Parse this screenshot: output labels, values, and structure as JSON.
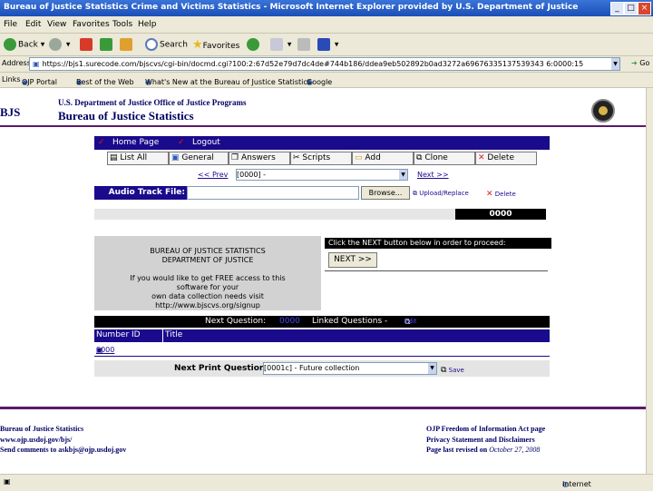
{
  "window": {
    "title": "Bureau of Justice Statistics Crime and Victims Statistics - Microsoft Internet Explorer provided by U.S. Department of Justice"
  },
  "menu": [
    "File",
    "Edit",
    "View",
    "Favorites",
    "Tools",
    "Help"
  ],
  "toolbar": {
    "back": "Back",
    "search": "Search",
    "favorites": "Favorites"
  },
  "address": {
    "label": "Address",
    "url": "https://bjs1.surecode.com/bjscvs/cgi-bin/docmd.cgi?100:2:67d52e79d7dc4de#744b186/ddea9eb502892b0ad3272a69676335137539343 6:0000:15",
    "go": "Go"
  },
  "links": {
    "label": "Links",
    "items": [
      "OJP Portal",
      "Best of the Web",
      "What's New at the Bureau of Justice Statistics",
      "Google"
    ]
  },
  "header": {
    "logo": "BJS",
    "line1": "U.S. Department of Justice Office of Justice Programs",
    "line2": "Bureau of Justice Statistics"
  },
  "nav": {
    "home": "Home Page",
    "logout": "Logout"
  },
  "buttons": [
    "List All",
    "General",
    "Answers",
    "Scripts",
    "Add",
    "Clone",
    "Delete"
  ],
  "pager": {
    "prev": "<< Prev",
    "select": "[0000] -",
    "next": "Next >>"
  },
  "audio": {
    "label": "Audio Track File:",
    "browse": "Browse...",
    "upload": "Upload/Replace",
    "delete": "Delete"
  },
  "counter": "0000",
  "info": {
    "l1": "BUREAU OF JUSTICE STATISTICS",
    "l2": "DEPARTMENT OF JUSTICE",
    "l3": "If you would like to get FREE access to this",
    "l4": "software for your",
    "l5": "own data collection needs visit",
    "l6": "http://www.bjscvs.org/signup"
  },
  "proceed": {
    "text": "Click the NEXT button below in order to proceed:",
    "button": "NEXT >>"
  },
  "nextq": {
    "label": "Next Question:",
    "value": "0000",
    "linked": "Linked Questions -",
    "edit": "Edit"
  },
  "table": {
    "col1": "Number ID",
    "col2": "Title",
    "row_id": "0000"
  },
  "print": {
    "label": "Next Print Question:",
    "select": "[0001c] - Future collection",
    "save": "Save"
  },
  "footer": {
    "left1": "Bureau of Justice Statistics",
    "left2": "www.ojp.usdoj.gov/bjs/",
    "left3": "Send comments to askbjs@ojp.usdoj.gov",
    "right1": "OJP Freedom of Information Act page",
    "right2": "Privacy Statement and Disclaimers",
    "right3": "Page last revised on",
    "right3_date": "October 27, 2008"
  },
  "status": {
    "zone": "Internet"
  }
}
